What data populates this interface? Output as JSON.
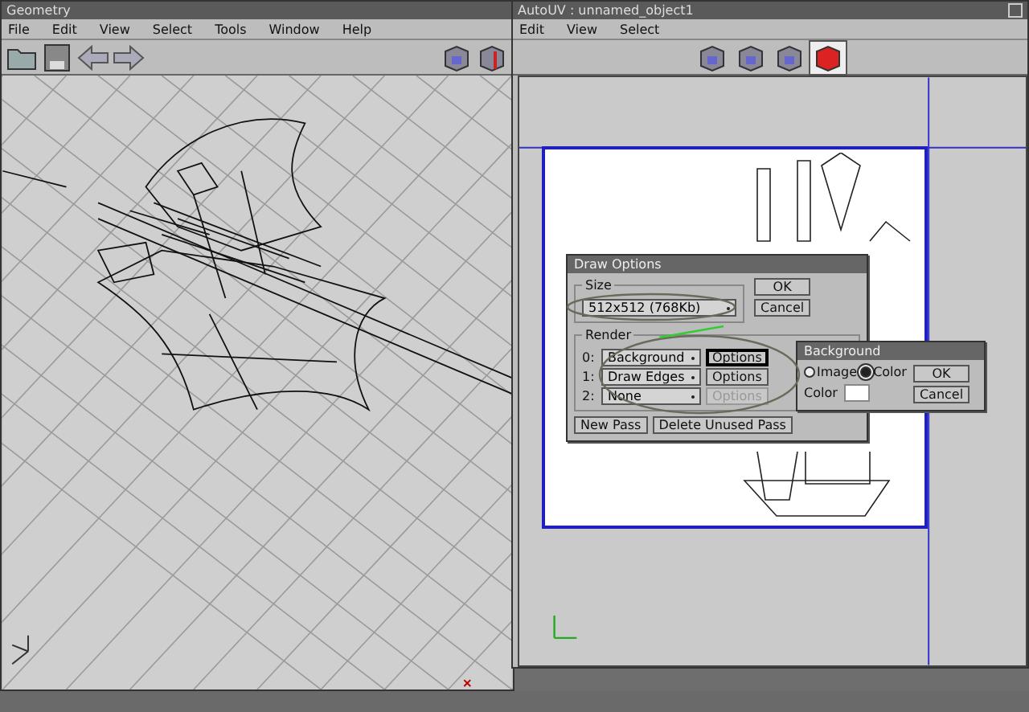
{
  "geometry_window": {
    "title": "Geometry",
    "menu": [
      "File",
      "Edit",
      "View",
      "Select",
      "Tools",
      "Window",
      "Help"
    ]
  },
  "autouv_window": {
    "title": "AutoUV : unnamed_object1",
    "menu": [
      "Edit",
      "View",
      "Select"
    ],
    "view_buttons": [
      {
        "selected": false
      },
      {
        "selected": false
      },
      {
        "selected": false
      },
      {
        "selected": true
      }
    ]
  },
  "draw_options": {
    "title": "Draw Options",
    "size_label": "Size",
    "size_value": "512x512 (768Kb)",
    "ok": "OK",
    "cancel": "Cancel",
    "render_label": "Render",
    "passes": [
      {
        "index": "0:",
        "value": "Background",
        "options": "Options",
        "selected": true,
        "disabled": false
      },
      {
        "index": "1:",
        "value": "Draw Edges",
        "options": "Options",
        "selected": false,
        "disabled": false
      },
      {
        "index": "2:",
        "value": "None",
        "options": "Options",
        "selected": false,
        "disabled": true
      }
    ],
    "new_pass": "New Pass",
    "delete_unused": "Delete Unused Pass"
  },
  "background_dialog": {
    "title": "Background",
    "sources": [
      {
        "label": "Image",
        "selected": false
      },
      {
        "label": "Color",
        "selected": true
      }
    ],
    "color_label": "Color",
    "ok": "OK",
    "cancel": "Cancel"
  }
}
